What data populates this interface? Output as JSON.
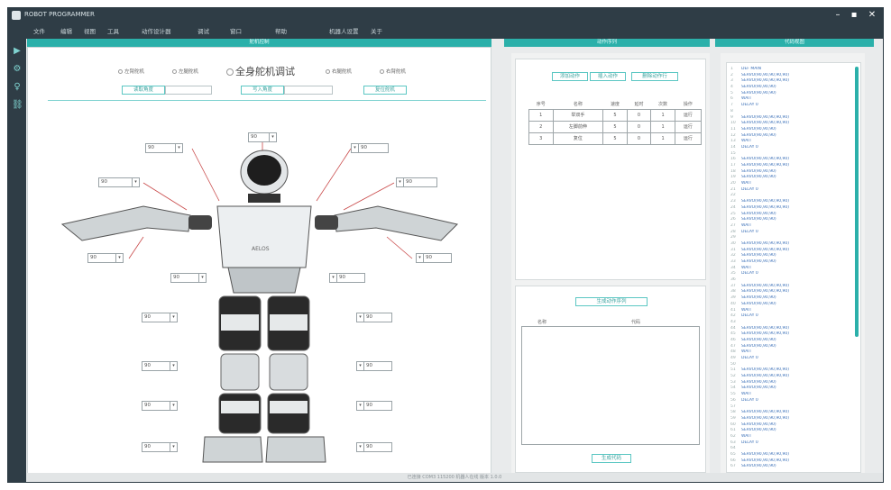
{
  "app": {
    "title": "ROBOT PROGRAMMER",
    "window_controls": {
      "minimize": "–",
      "maximize": "▪",
      "close": "✕"
    }
  },
  "menu": [
    "文件",
    "编辑",
    "视图",
    "工具",
    "动作设计器",
    "调试",
    "窗口",
    "帮助",
    "机器人设置",
    "关于"
  ],
  "toolstrip": [
    "play-icon",
    "servo-icon",
    "figure-icon",
    "network-icon"
  ],
  "panels": {
    "left_title": "舵机控制",
    "mid_title": "动作序列",
    "right_title": "代码视图"
  },
  "left": {
    "radios": {
      "left_arm": "左臂舵机",
      "left_leg": "左腿舵机",
      "full": "全身舵机调试",
      "right_leg": "右腿舵机",
      "right_arm": "右臂舵机"
    },
    "buttons": {
      "read": "读取角度",
      "write": "写入角度",
      "reset": "复位舵机"
    },
    "servos": {
      "head": "90",
      "l_shoulder": "90",
      "r_shoulder": "90",
      "l_upper": "90",
      "r_upper": "90",
      "l_hand": "90",
      "r_hand": "90",
      "l_hip": "90",
      "r_hip": "90",
      "l_thigh": "90",
      "r_thigh": "90",
      "l_knee": "90",
      "r_knee": "90",
      "l_shin": "90",
      "r_shin": "90",
      "l_foot": "90",
      "r_foot": "90"
    },
    "robot_logo": "AELOS"
  },
  "mid": {
    "tabs": [
      "添加动作",
      "插入动作",
      "删除动作行"
    ],
    "table": {
      "headers": [
        "序号",
        "名称",
        "速度",
        "延时",
        "次数",
        "操作"
      ],
      "rows": [
        [
          "1",
          "举双手",
          "5",
          "0",
          "1",
          "运行"
        ],
        [
          "2",
          "左脚前伸",
          "5",
          "0",
          "1",
          "运行"
        ],
        [
          "3",
          "复位",
          "5",
          "0",
          "1",
          "运行"
        ]
      ]
    },
    "sequence_button": "生成动作序列",
    "seq_headers": [
      "名称",
      "代码"
    ],
    "generate_button": "生成代码"
  },
  "code": {
    "lines": [
      "DEF MAIN",
      "SERVO(90,90,90,90,90)",
      "SERVO(90,90,90,90,90)",
      "SERVO(90,90,90)",
      "SERVO(90,90,90)",
      "WAIT",
      "DELAY 0",
      "",
      "SERVO(90,90,90,90,90)",
      "SERVO(90,90,90,90,90)",
      "SERVO(90,90,90)",
      "SERVO(90,90,90)",
      "WAIT",
      "DELAY 0",
      "",
      "SERVO(90,90,90,90,90)",
      "SERVO(90,90,90,90,90)",
      "SERVO(90,90,90)",
      "SERVO(90,90,90)",
      "WAIT",
      "DELAY 0",
      "",
      "SERVO(90,90,90,90,90)",
      "SERVO(90,90,90,90,90)",
      "SERVO(90,90,90)",
      "SERVO(90,90,90)",
      "WAIT",
      "DELAY 0",
      "",
      "SERVO(90,90,90,90,90)",
      "SERVO(90,90,90,90,90)",
      "SERVO(90,90,90)",
      "SERVO(90,90,90)",
      "WAIT",
      "DELAY 0",
      "",
      "SERVO(90,90,90,90,90)",
      "SERVO(90,90,90,90,90)",
      "SERVO(90,90,90)",
      "SERVO(90,90,90)",
      "WAIT",
      "DELAY 0",
      "",
      "SERVO(90,90,90,90,90)",
      "SERVO(90,90,90,90,90)",
      "SERVO(90,90,90)",
      "SERVO(90,90,90)",
      "WAIT",
      "DELAY 0",
      "",
      "SERVO(90,90,90,90,90)",
      "SERVO(90,90,90,90,90)",
      "SERVO(90,90,90)",
      "SERVO(90,90,90)",
      "WAIT",
      "DELAY 0",
      "",
      "SERVO(90,90,90,90,90)",
      "SERVO(90,90,90,90,90)",
      "SERVO(90,90,90)",
      "SERVO(90,90,90)",
      "WAIT",
      "DELAY 0",
      "",
      "SERVO(90,90,90,90,90)",
      "SERVO(90,90,90,90,90)",
      "SERVO(90,90,90)"
    ]
  },
  "status": "已连接 COM3 115200 机器人在线 版本 1.0.0",
  "colors": {
    "accent": "#2bb0aa",
    "titlebar": "#2f3d46",
    "code_text": "#3a6fb7"
  }
}
